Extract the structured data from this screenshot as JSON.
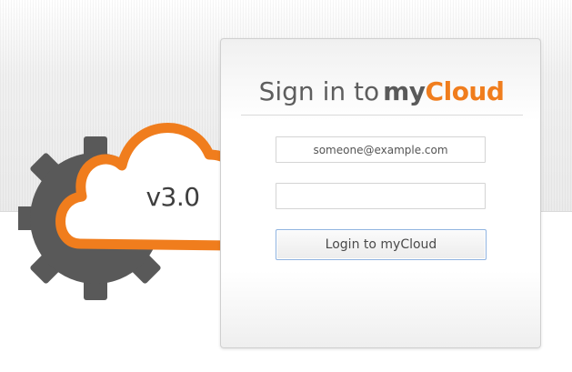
{
  "branding": {
    "version": "v3.0",
    "logo_icon": "gear-cloud-logo",
    "accent_color": "#f07d1d",
    "gear_color": "#595959"
  },
  "login": {
    "title_prefix": "Sign in to",
    "brand_my": "my",
    "brand_cloud": "Cloud",
    "email_placeholder": "someone@example.com",
    "email_value": "",
    "password_value": "",
    "submit_label": "Login to myCloud"
  }
}
